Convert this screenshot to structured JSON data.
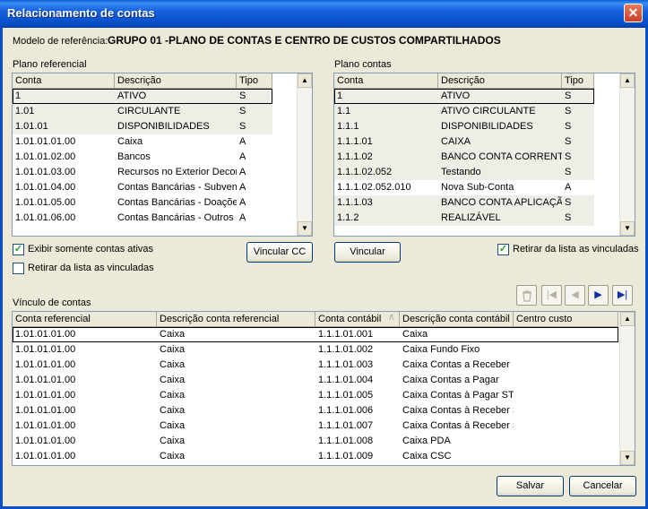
{
  "window": {
    "title": "Relacionamento de contas"
  },
  "modelo": {
    "label": "Modelo de referência:",
    "value": "GRUPO 01 -PLANO DE CONTAS E CENTRO DE CUSTOS COMPARTILHADOS"
  },
  "plano_referencial": {
    "label": "Plano referencial",
    "columns": [
      "Conta",
      "Descrição",
      "Tipo"
    ],
    "rows": [
      {
        "conta": "1",
        "descricao": "ATIVO",
        "tipo": "S"
      },
      {
        "conta": "1.01",
        "descricao": "CIRCULANTE",
        "tipo": "S"
      },
      {
        "conta": "1.01.01",
        "descricao": "DISPONIBILIDADES",
        "tipo": "S"
      },
      {
        "conta": "1.01.01.01.00",
        "descricao": "Caixa",
        "tipo": "A"
      },
      {
        "conta": "1.01.01.02.00",
        "descricao": "Bancos",
        "tipo": "A"
      },
      {
        "conta": "1.01.01.03.00",
        "descricao": "Recursos no Exterior Decorr",
        "tipo": "A"
      },
      {
        "conta": "1.01.01.04.00",
        "descricao": "Contas Bancárias - Subvenç",
        "tipo": "A"
      },
      {
        "conta": "1.01.01.05.00",
        "descricao": "Contas Bancárias - Doaçõe",
        "tipo": "A"
      },
      {
        "conta": "1.01.01.06.00",
        "descricao": "Contas Bancárias - Outros R",
        "tipo": "A"
      }
    ]
  },
  "plano_contas": {
    "label": "Plano contas",
    "columns": [
      "Conta",
      "Descrição",
      "Tipo"
    ],
    "rows": [
      {
        "conta": "1",
        "descricao": "ATIVO",
        "tipo": "S"
      },
      {
        "conta": "1.1",
        "descricao": "ATIVO CIRCULANTE",
        "tipo": "S"
      },
      {
        "conta": "1.1.1",
        "descricao": "DISPONIBILIDADES",
        "tipo": "S"
      },
      {
        "conta": "1.1.1.01",
        "descricao": "CAIXA",
        "tipo": "S"
      },
      {
        "conta": "1.1.1.02",
        "descricao": "BANCO CONTA CORRENT",
        "tipo": "S"
      },
      {
        "conta": "1.1.1.02.052",
        "descricao": "Testando",
        "tipo": "S"
      },
      {
        "conta": "1.1.1.02.052.010",
        "descricao": "Nova Sub-Conta",
        "tipo": "A"
      },
      {
        "conta": "1.1.1.03",
        "descricao": "BANCO CONTA APLICAÇÃ",
        "tipo": "S"
      },
      {
        "conta": "1.1.2",
        "descricao": "REALIZÁVEL",
        "tipo": "S"
      }
    ]
  },
  "options": {
    "exibir_ativas": "Exibir somente contas ativas",
    "retirar_left": "Retirar da lista as vinculadas",
    "retirar_right": "Retirar da lista as vinculadas"
  },
  "buttons": {
    "vincular_cc": "Vincular CC",
    "vincular": "Vincular",
    "salvar": "Salvar",
    "cancelar": "Cancelar"
  },
  "vinculo": {
    "label": "Vínculo de contas",
    "columns": [
      "Conta referencial",
      "Descrição conta referencial",
      "Conta contábil",
      "Descrição conta contábil",
      "Centro custo"
    ],
    "sort_indicator": "/\\",
    "rows": [
      {
        "conta_ref": "1.01.01.01.00",
        "desc_ref": "Caixa",
        "conta_contabil": "1.1.1.01.001",
        "desc_contabil": "Caixa",
        "centro": ""
      },
      {
        "conta_ref": "1.01.01.01.00",
        "desc_ref": "Caixa",
        "conta_contabil": "1.1.1.01.002",
        "desc_contabil": "Caixa Fundo Fixo",
        "centro": ""
      },
      {
        "conta_ref": "1.01.01.01.00",
        "desc_ref": "Caixa",
        "conta_contabil": "1.1.1.01.003",
        "desc_contabil": "Caixa Contas a Receber",
        "centro": ""
      },
      {
        "conta_ref": "1.01.01.01.00",
        "desc_ref": "Caixa",
        "conta_contabil": "1.1.1.01.004",
        "desc_contabil": "Caixa Contas a Pagar",
        "centro": ""
      },
      {
        "conta_ref": "1.01.01.01.00",
        "desc_ref": "Caixa",
        "conta_contabil": "1.1.1.01.005",
        "desc_contabil": "Caixa Contas à Pagar ST",
        "centro": ""
      },
      {
        "conta_ref": "1.01.01.01.00",
        "desc_ref": "Caixa",
        "conta_contabil": "1.1.1.01.006",
        "desc_contabil": "Caixa Contas à Receber S",
        "centro": ""
      },
      {
        "conta_ref": "1.01.01.01.00",
        "desc_ref": "Caixa",
        "conta_contabil": "1.1.1.01.007",
        "desc_contabil": "Caixa Contas à Receber S",
        "centro": ""
      },
      {
        "conta_ref": "1.01.01.01.00",
        "desc_ref": "Caixa",
        "conta_contabil": "1.1.1.01.008",
        "desc_contabil": "Caixa PDA",
        "centro": ""
      },
      {
        "conta_ref": "1.01.01.01.00",
        "desc_ref": "Caixa",
        "conta_contabil": "1.1.1.01.009",
        "desc_contabil": "Caixa CSC",
        "centro": ""
      }
    ]
  },
  "icons": {
    "close": "close-icon",
    "delete": "recycle-bin-icon",
    "first": "first-record-icon",
    "prev": "previous-record-icon",
    "next": "next-record-icon",
    "last": "last-record-icon"
  },
  "colors": {
    "titlebar": "#0850c8",
    "navigator_active": "#0b2fa8"
  }
}
